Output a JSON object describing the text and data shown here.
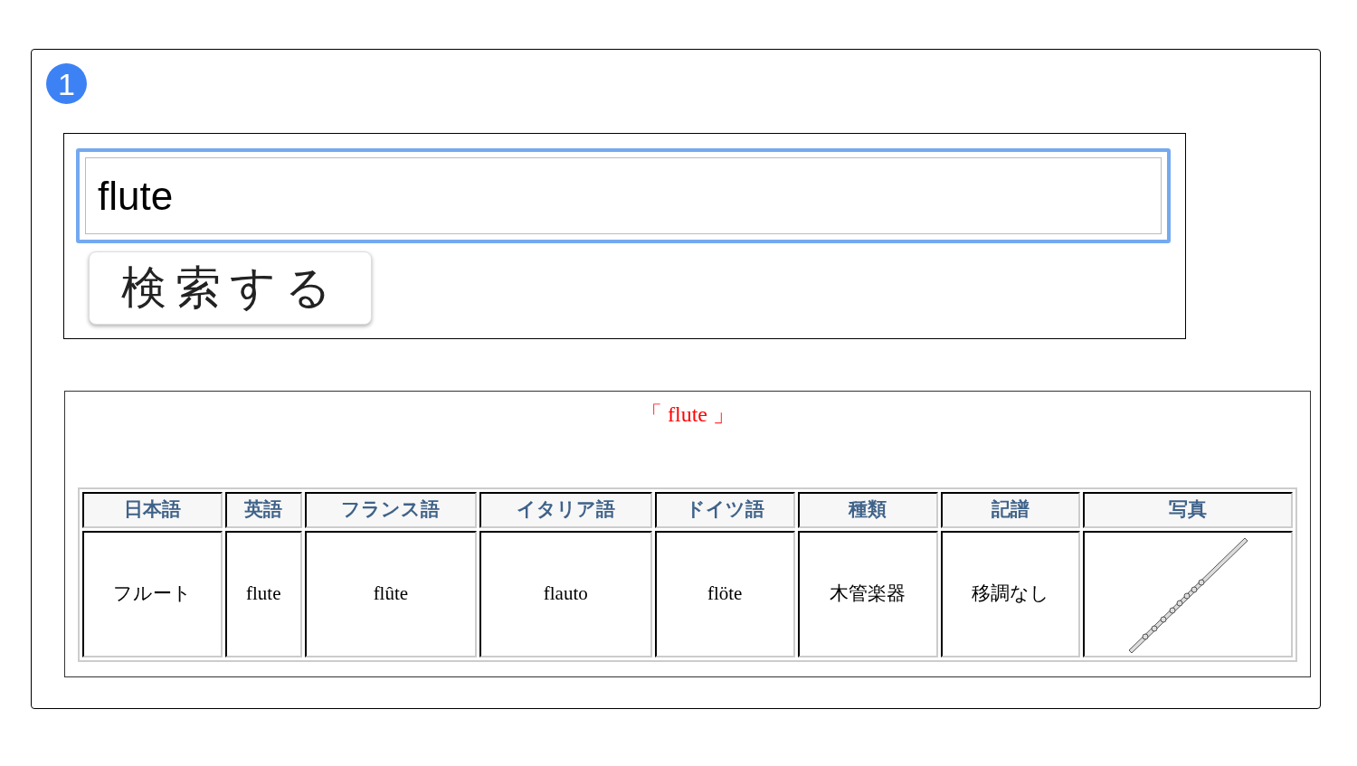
{
  "step_badge": "1",
  "search": {
    "value": "flute",
    "button": "検索する"
  },
  "results": {
    "title": "「 flute 」",
    "columns": [
      "日本語",
      "英語",
      "フランス語",
      "イタリア語",
      "ドイツ語",
      "種類",
      "記譜",
      "写真"
    ],
    "rows": [
      {
        "cells": [
          "フルート",
          "flute",
          "flûte",
          "flauto",
          "flöte",
          "木管楽器",
          "移調なし"
        ],
        "photo": true
      }
    ]
  }
}
